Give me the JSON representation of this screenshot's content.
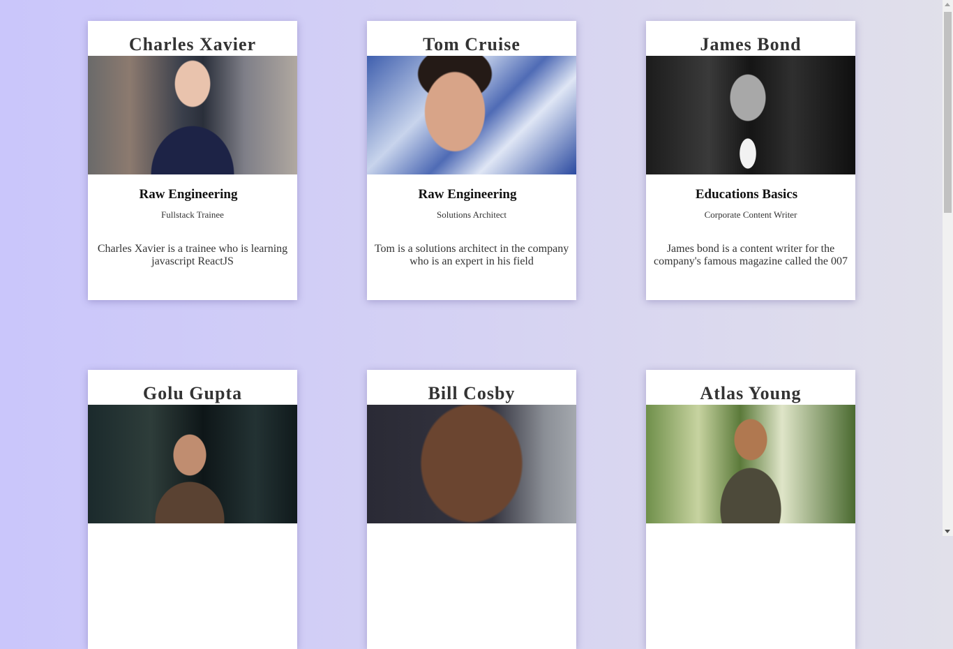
{
  "cards": [
    {
      "name": "Charles Xavier",
      "company": "Raw Engineering",
      "role": "Fullstack Trainee",
      "description": "Charles Xavier is a trainee who is learning javascript ReactJS"
    },
    {
      "name": "Tom Cruise",
      "company": "Raw Engineering",
      "role": "Solutions Architect",
      "description": "Tom is a solutions architect in the company who is an expert in his field"
    },
    {
      "name": "James Bond",
      "company": "Educations Basics",
      "role": "Corporate Content Writer",
      "description": "James bond is a content writer for the company's famous magazine called the 007"
    },
    {
      "name": "Golu Gupta"
    },
    {
      "name": "Bill Cosby"
    },
    {
      "name": "Atlas Young"
    }
  ]
}
